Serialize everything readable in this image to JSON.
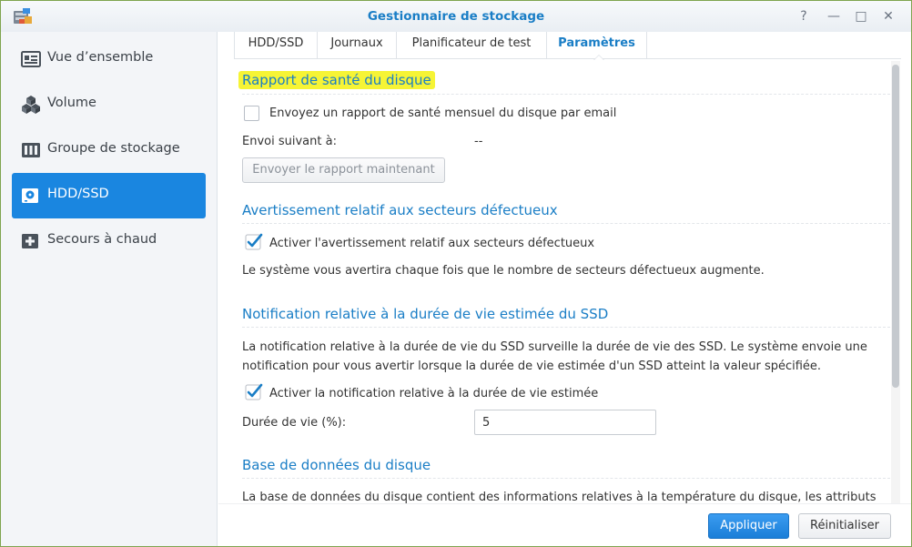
{
  "window": {
    "title": "Gestionnaire de stockage",
    "help_label": "?",
    "minimize_label": "—",
    "maximize_label": "□",
    "close_label": "✕"
  },
  "sidebar": {
    "items": [
      {
        "label": "Vue d’ensemble",
        "icon": "overview-icon"
      },
      {
        "label": "Volume",
        "icon": "volume-cubes-icon"
      },
      {
        "label": "Groupe de stockage",
        "icon": "storage-pool-icon"
      },
      {
        "label": "HDD/SSD",
        "icon": "hdd-icon",
        "active": true
      },
      {
        "label": "Secours à chaud",
        "icon": "hot-spare-icon"
      }
    ]
  },
  "tabs": [
    {
      "label": "HDD/SSD"
    },
    {
      "label": "Journaux"
    },
    {
      "label": "Planificateur de test"
    },
    {
      "label": "Paramètres",
      "active": true
    }
  ],
  "sections": {
    "health_report": {
      "title": "Rapport de santé du disque",
      "email_checkbox_label": "Envoyez un rapport de santé mensuel du disque par email",
      "email_checked": false,
      "next_send_label": "Envoi suivant à:",
      "next_send_value": "--",
      "send_now_button": "Envoyer le rapport maintenant"
    },
    "bad_sectors": {
      "title": "Avertissement relatif aux secteurs défectueux",
      "checkbox_label": "Activer l'avertissement relatif aux secteurs défectueux",
      "checked": true,
      "description": "Le système vous avertira chaque fois que le nombre de secteurs défectueux augmente."
    },
    "ssd_lifespan": {
      "title": "Notification relative à la durée de vie estimée du SSD",
      "description_line1": "La notification relative à la durée de vie du SSD surveille la durée de vie des SSD. Le système envoie une",
      "description_line2": "notification pour vous avertir lorsque la durée de vie estimée d'un SSD atteint la valeur spécifiée.",
      "checkbox_label": "Activer la notification relative à la durée de vie estimée",
      "checked": true,
      "lifespan_label": "Durée de vie (%):",
      "lifespan_value": "5"
    },
    "disk_db": {
      "title": "Base de données du disque",
      "description": "La base de données du disque contient des informations relatives à la température du disque, les attributs"
    }
  },
  "footer": {
    "apply_label": "Appliquer",
    "reset_label": "Réinitialiser"
  },
  "colors": {
    "accent": "#1a7ec6",
    "active_nav": "#1a86e0",
    "highlight": "#f6f435"
  }
}
